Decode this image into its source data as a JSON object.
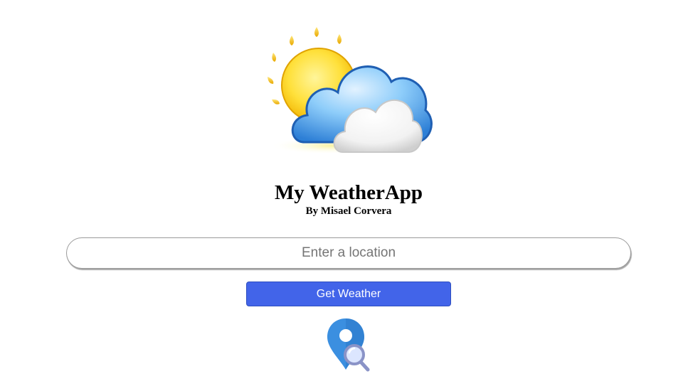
{
  "header": {
    "title": "My WeatherApp",
    "subtitle": "By Misael Corvera"
  },
  "search": {
    "placeholder": "Enter a location",
    "value": ""
  },
  "actions": {
    "get_weather_label": "Get Weather"
  },
  "icons": {
    "logo": "sun-behind-clouds-icon",
    "location": "location-search-icon"
  },
  "colors": {
    "button_background": "#4264e9",
    "button_text": "#ffffff",
    "pin": "#3b8fe0"
  }
}
